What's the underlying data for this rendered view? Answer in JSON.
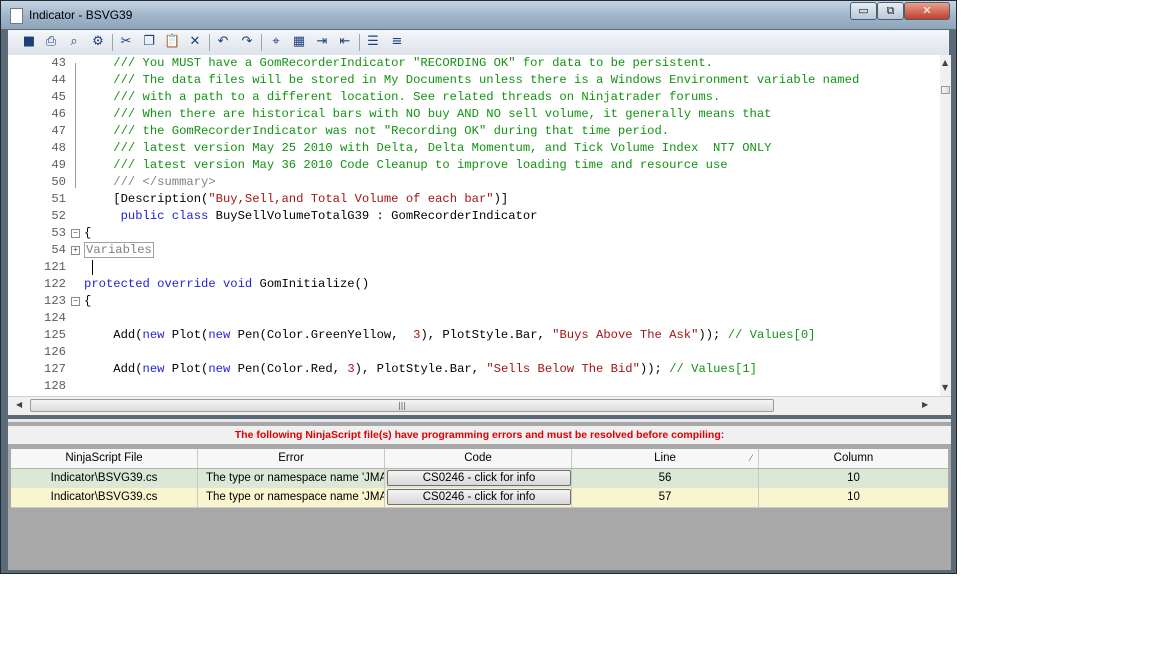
{
  "window": {
    "title": "Indicator - BSVG39",
    "minimize_glyph": "▭",
    "restore_glyph": "⧉",
    "close_glyph": "✕"
  },
  "toolbar": {
    "icons": [
      "save-icon",
      "print-icon",
      "print-preview-icon",
      "page-setup-icon",
      "cut-icon",
      "copy-icon",
      "paste-icon",
      "delete-icon",
      "undo-icon",
      "redo-icon",
      "find-icon",
      "find-replace-icon",
      "indent-icon",
      "outdent-icon",
      "comment-icon",
      "uncomment-icon"
    ]
  },
  "editor": {
    "lines": [
      {
        "num": "43",
        "parts": [
          {
            "t": "    /// You MUST have a GomRecorderIndicator \"RECORDING OK\" for data to be persistent.",
            "c": "com"
          }
        ]
      },
      {
        "num": "44",
        "parts": [
          {
            "t": "    /// The data files will be stored in My Documents unless there is a Windows Environment variable named",
            "c": "com"
          }
        ]
      },
      {
        "num": "45",
        "parts": [
          {
            "t": "    /// with a path to a different location. See related threads on Ninjatrader forums.",
            "c": "com"
          }
        ]
      },
      {
        "num": "46",
        "parts": [
          {
            "t": "    /// When there are historical bars with NO buy AND NO sell volume, it generally means that",
            "c": "com"
          }
        ]
      },
      {
        "num": "47",
        "parts": [
          {
            "t": "    /// the GomRecorderIndicator was not \"Recording OK\" during that time period.",
            "c": "com"
          }
        ]
      },
      {
        "num": "48",
        "parts": [
          {
            "t": "    /// latest version May 25 2010 with Delta, Delta Momentum, and Tick Volume Index  NT7 ONLY",
            "c": "com"
          }
        ]
      },
      {
        "num": "49",
        "parts": [
          {
            "t": "    /// latest version May 36 2010 Code Cleanup to improve loading time and resource use",
            "c": "com"
          }
        ]
      },
      {
        "num": "50",
        "parts": [
          {
            "t": "    /// ",
            "c": "gray"
          },
          {
            "t": "</summary>",
            "c": "gray"
          }
        ]
      },
      {
        "num": "51",
        "parts": [
          {
            "t": "    [Description(",
            "c": "plain"
          },
          {
            "t": "\"Buy,Sell,and Total Volume of each bar\"",
            "c": "str"
          },
          {
            "t": ")]",
            "c": "plain"
          }
        ]
      },
      {
        "num": "52",
        "parts": [
          {
            "t": "     ",
            "c": "plain"
          },
          {
            "t": "public class",
            "c": "kw"
          },
          {
            "t": " BuySellVolumeTotalG39 : GomRecorderIndicator",
            "c": "plain"
          }
        ]
      },
      {
        "num": "53",
        "parts": [
          {
            "t": "{",
            "c": "plain"
          }
        ]
      },
      {
        "num": "54",
        "parts": [
          {
            "t": "Variables",
            "c": "region"
          }
        ]
      },
      {
        "num": "121",
        "parts": [
          {
            "t": "",
            "c": "plain"
          }
        ]
      },
      {
        "num": "122",
        "parts": [
          {
            "t": "protected override void",
            "c": "kw"
          },
          {
            "t": " GomInitialize()",
            "c": "plain"
          }
        ]
      },
      {
        "num": "123",
        "parts": [
          {
            "t": "{",
            "c": "plain"
          }
        ]
      },
      {
        "num": "124",
        "parts": [
          {
            "t": "",
            "c": "plain"
          }
        ]
      },
      {
        "num": "125",
        "parts": [
          {
            "t": "    Add(",
            "c": "plain"
          },
          {
            "t": "new",
            "c": "kw"
          },
          {
            "t": " Plot(",
            "c": "plain"
          },
          {
            "t": "new",
            "c": "kw"
          },
          {
            "t": " Pen(Color.GreenYellow,  ",
            "c": "plain"
          },
          {
            "t": "3",
            "c": "str"
          },
          {
            "t": "), PlotStyle.Bar, ",
            "c": "plain"
          },
          {
            "t": "\"Buys Above The Ask\"",
            "c": "str"
          },
          {
            "t": ")); ",
            "c": "plain"
          },
          {
            "t": "// Values[0]",
            "c": "com"
          }
        ]
      },
      {
        "num": "126",
        "parts": [
          {
            "t": "",
            "c": "plain"
          }
        ]
      },
      {
        "num": "127",
        "parts": [
          {
            "t": "    Add(",
            "c": "plain"
          },
          {
            "t": "new",
            "c": "kw"
          },
          {
            "t": " Plot(",
            "c": "plain"
          },
          {
            "t": "new",
            "c": "kw"
          },
          {
            "t": " Pen(Color.Red, ",
            "c": "plain"
          },
          {
            "t": "3",
            "c": "str"
          },
          {
            "t": "), PlotStyle.Bar, ",
            "c": "plain"
          },
          {
            "t": "\"Sells Below The Bid\"",
            "c": "str"
          },
          {
            "t": ")); ",
            "c": "plain"
          },
          {
            "t": "// Values[1]",
            "c": "com"
          }
        ]
      },
      {
        "num": "128",
        "parts": [
          {
            "t": "",
            "c": "plain"
          }
        ]
      }
    ]
  },
  "errors": {
    "message": "The following NinjaScript file(s) have programming errors and must be resolved before compiling:",
    "columns": [
      "NinjaScript File",
      "Error",
      "Code",
      "Line",
      "Column"
    ],
    "rows": [
      {
        "file": "Indicator\\BSVG39.cs",
        "error": "The type or namespace name 'JMA",
        "code": "CS0246 - click for info",
        "line": "56",
        "column": "10"
      },
      {
        "file": "Indicator\\BSVG39.cs",
        "error": "The type or namespace name 'JMA",
        "code": "CS0246 - click for info",
        "line": "57",
        "column": "10"
      }
    ]
  },
  "colors": {
    "comment": "#129312",
    "keyword": "#2222d8",
    "string": "#a31515",
    "error_text": "#e00000",
    "row_selected": "#dbe8d6",
    "row_alt": "#f9f6cf"
  }
}
